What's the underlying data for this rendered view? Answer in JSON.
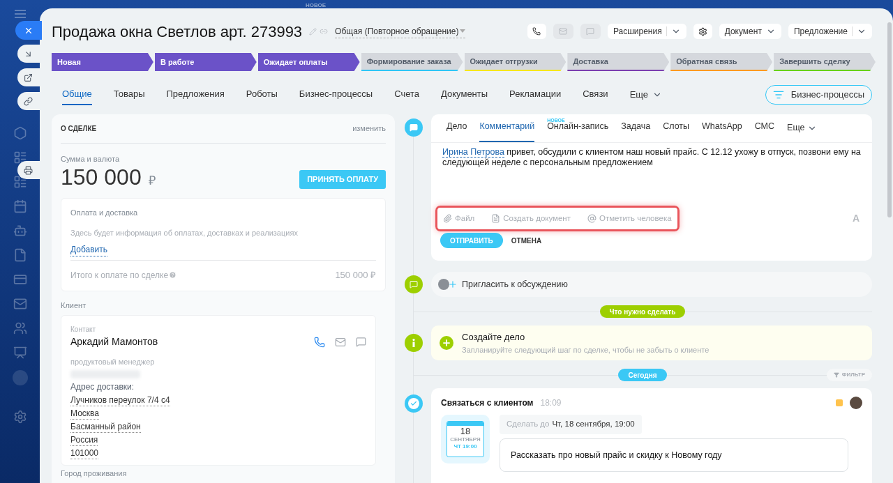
{
  "background_label": "НОВОЕ",
  "deal": {
    "title": "Продажа окна Светлов арт. 273993",
    "category": "Общая (Повторное обращение)"
  },
  "header_buttons": [
    {
      "label": "Расширения",
      "kind": "split"
    },
    {
      "label": "Документ",
      "kind": "dropdown"
    },
    {
      "label": "Предложение",
      "kind": "split"
    }
  ],
  "stages": [
    {
      "label": "Новая",
      "reached": true,
      "color": "#6b52c8"
    },
    {
      "label": "В работе",
      "reached": true,
      "color": "#6b52c8"
    },
    {
      "label": "Ожидает оплаты",
      "reached": true,
      "color": "#6b52c8"
    },
    {
      "label": "Формирование заказа",
      "reached": false,
      "color": "#2fc6f6"
    },
    {
      "label": "Ожидает отгрузки",
      "reached": false,
      "color": "#f6e71c"
    },
    {
      "label": "Доставка",
      "reached": false,
      "color": "#7b3fb0"
    },
    {
      "label": "Обратная связь",
      "reached": false,
      "color": "#ff9a1f"
    },
    {
      "label": "Завершить сделку",
      "reached": false,
      "color": "#68d21a"
    }
  ],
  "tabs": [
    {
      "label": "Общие",
      "selected": true
    },
    {
      "label": "Товары",
      "selected": false
    },
    {
      "label": "Предложения",
      "selected": false
    },
    {
      "label": "Роботы",
      "selected": false
    },
    {
      "label": "Бизнес-процессы",
      "selected": false
    },
    {
      "label": "Счета",
      "selected": false
    },
    {
      "label": "Документы",
      "selected": false
    },
    {
      "label": "Рекламации",
      "selected": false
    },
    {
      "label": "Связи",
      "selected": false
    }
  ],
  "more_tab": "Еще",
  "bp_button": "Бизнес-процессы",
  "about": {
    "title": "О СДЕЛКЕ",
    "edit": "изменить",
    "amount_label": "Сумма и валюта",
    "amount": "150 000",
    "currency": "₽",
    "pay_button": "ПРИНЯТЬ ОПЛАТУ",
    "payment": {
      "title": "Оплата и доставка",
      "info": "Здесь будет информация об оплатах, доставках и реализациях",
      "add": "Добавить",
      "total_label": "Итого к оплате по сделке",
      "total": "150 000 ₽"
    }
  },
  "client": {
    "title": "Клиент",
    "contact_label": "Контакт",
    "name": "Аркадий Мамонтов",
    "position": "продуктовый менеджер",
    "address_label": "Адрес доставки:",
    "address": [
      "Лучников переулок 7/4 с4",
      "Москва",
      "Басманный район",
      "Россия",
      "101000"
    ]
  },
  "next_section": "Город проживания",
  "composer": {
    "tabs": [
      {
        "label": "Дело",
        "selected": false
      },
      {
        "label": "Комментарий",
        "selected": true
      },
      {
        "label": "Онлайн-запись",
        "selected": false,
        "badge": "НОВОЕ"
      },
      {
        "label": "Задача",
        "selected": false
      },
      {
        "label": "Слоты",
        "selected": false
      },
      {
        "label": "WhatsApp",
        "selected": false
      },
      {
        "label": "СМС",
        "selected": false
      }
    ],
    "more": "Еще",
    "mention": "Ирина Петрова",
    "text": " привет, обсудили с клиентом наш новый прайс. С 12.12 ухожу в отпуск, позвони ему на следующей неделе с персональным предложением",
    "tools": [
      {
        "label": "Файл",
        "kind": "file"
      },
      {
        "label": "Создать документ",
        "kind": "document"
      },
      {
        "label": "Отметить человека",
        "kind": "mention"
      }
    ],
    "format": "A",
    "send": "ОТПРАВИТЬ",
    "cancel": "ОТМЕНА"
  },
  "invite": "Пригласить к обсуждению",
  "todo_divider": "Что нужно сделать",
  "create": {
    "title": "Создайте дело",
    "hint": "Запланируйте следующий шаг по сделке, чтобы не забыть о клиенте"
  },
  "today_divider": "Сегодня",
  "filter": "ФИЛЬТР",
  "activity": {
    "title": "Связаться с клиентом",
    "time": "18:09",
    "calendar": {
      "day": "18",
      "month": "СЕНТЯБРЯ",
      "time": "ЧТ 19:00"
    },
    "deadline_label": "Сделать до",
    "deadline": "Чт, 18 сентября, 19:00",
    "description": "Рассказать про новый прайс и скидку к Новому году"
  }
}
